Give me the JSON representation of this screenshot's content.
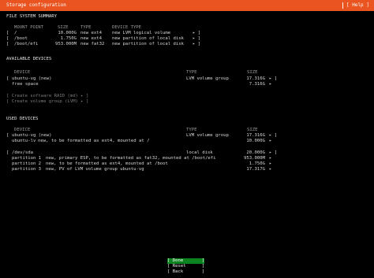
{
  "window": {
    "title": "Storage configuration",
    "help_label": "[ Help ]"
  },
  "fs_summary": {
    "heading": "FILE SYSTEM SUMMARY",
    "columns": {
      "mount": "MOUNT POINT",
      "size": "SIZE",
      "type": "TYPE",
      "device": "DEVICE TYPE"
    },
    "rows": [
      {
        "prefix": "[",
        "mount": "/",
        "size": "10.000G",
        "type": "new ext4",
        "device": "new LVM logical volume",
        "arrow": "▸ ]"
      },
      {
        "prefix": "[",
        "mount": "/boot",
        "size": "1.750G",
        "type": "new ext4",
        "device": "new partition of local disk",
        "arrow": "▸ ]"
      },
      {
        "prefix": "[",
        "mount": "/boot/efi",
        "size": "953.000M",
        "type": "new fat32",
        "device": "new partition of local disk",
        "arrow": "▸ ]"
      }
    ]
  },
  "available": {
    "heading": "AVAILABLE DEVICES",
    "columns": {
      "device": "DEVICE",
      "type": "TYPE",
      "size": "SIZE"
    },
    "ubuntu_vg": {
      "prefix": "[",
      "name": "ubuntu-vg (new)",
      "type": "LVM volume group",
      "size": "17.316G",
      "arrow": "▸ ]"
    },
    "free_space": {
      "name": "free space",
      "size": "7.316G",
      "arrow": "▸"
    },
    "create_raid": "[ Create software RAID (md) ▸ ]",
    "create_lvm": "[ Create volume group (LVM) ▸ ]"
  },
  "used": {
    "heading": "USED DEVICES",
    "columns": {
      "device": "DEVICE",
      "type": "TYPE",
      "size": "SIZE"
    },
    "ubuntu_vg": {
      "prefix": "[",
      "name": "ubuntu-vg (new)",
      "type": "LVM volume group",
      "size": "17.316G",
      "arrow": "▸ ]"
    },
    "ubuntu_lv": {
      "name": "ubuntu-lv",
      "desc": "new, to be formatted as ext4, mounted at /",
      "size": "10.000G",
      "arrow": "▸"
    },
    "sda": {
      "prefix": "[",
      "name": "/dev/sda",
      "type": "local disk",
      "size": "20.000G",
      "arrow": "▸ ]"
    },
    "partitions": [
      {
        "name": "partition 1",
        "desc": "new, primary ESP, to be formatted as fat32, mounted at /boot/efi",
        "size": "953.000M",
        "arrow": "▸"
      },
      {
        "name": "partition 2",
        "desc": "new, to be formatted as ext4, mounted at /boot",
        "size": "1.750G",
        "arrow": "▸"
      },
      {
        "name": "partition 3",
        "desc": "new, PV of LVM volume group ubuntu-vg",
        "size": "17.317G",
        "arrow": "▸"
      }
    ]
  },
  "buttons": {
    "done": "[ Done       ]",
    "reset": "[ Reset      ]",
    "back": "[ Back       ]"
  },
  "colors": {
    "header": "#e95420",
    "primary_button": "#0e8420",
    "background": "#000000"
  }
}
